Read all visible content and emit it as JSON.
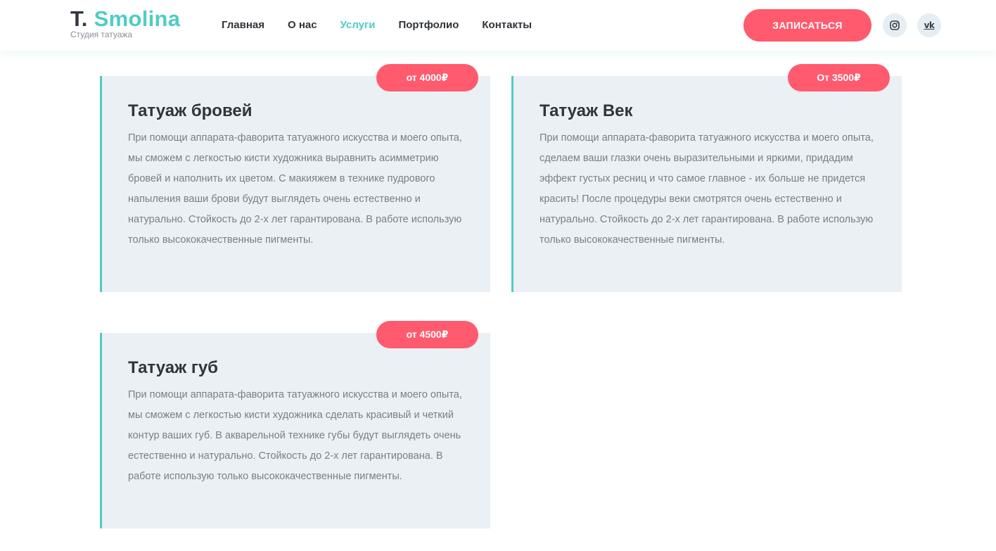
{
  "header": {
    "logo_prefix": "T.",
    "logo_name": "Smolina",
    "logo_subtitle": "Студия татуажа",
    "nav": [
      {
        "label": "Главная",
        "active": false
      },
      {
        "label": "О нас",
        "active": false
      },
      {
        "label": "Услуги",
        "active": true
      },
      {
        "label": "Портфолио",
        "active": false
      },
      {
        "label": "Контакты",
        "active": false
      }
    ],
    "cta_label": "ЗАПИСАТЬСЯ",
    "social_icons": [
      "instagram-icon",
      "vk-icon"
    ],
    "vk_glyph": "vk"
  },
  "services": [
    {
      "title": "Татуаж бровей",
      "price": "от 4000₽",
      "description": "При помощи аппарата-фаворита татуажного искусства и моего опыта, мы сможем с легкостью кисти художника выравнить асимметрию бровей и наполнить их цветом. С макияжем в технике пудрового напыления ваши брови будут выглядеть очень естественно и натурально. Стойкость до 2-х лет гарантирована. В работе использую только высококачественные пигменты."
    },
    {
      "title": "Татуаж Век",
      "price": "От 3500₽",
      "description": "При помощи аппарата-фаворита татуажного искусства и моего опыта, сделаем ваши глазки очень выразительными и яркими, придадим эффект густых ресниц и что самое главное - их больше не придется красить! После процедуры веки смотрятся очень естественно и натурально. Стойкость до 2-х лет гарантирована. В работе использую только высококачественные пигменты."
    },
    {
      "title": "Татуаж губ",
      "price": "от 4500₽",
      "description": "При помощи аппарата-фаворита татуажного искусства и моего опыта, мы сможем с легкостью кисти художника сделать красивый и четкий контур ваших губ. В акварельной технике губы будут выглядеть очень естественно и натурально. Стойкость до 2-х лет гарантирована. В работе использую только высококачественные пигменты."
    }
  ],
  "colors": {
    "accent_teal": "#4ecdc4",
    "accent_pink": "#ff5a6e",
    "card_bg": "#eaf0f4",
    "text_dark": "#30353b",
    "text_muted": "#7a7f86"
  }
}
